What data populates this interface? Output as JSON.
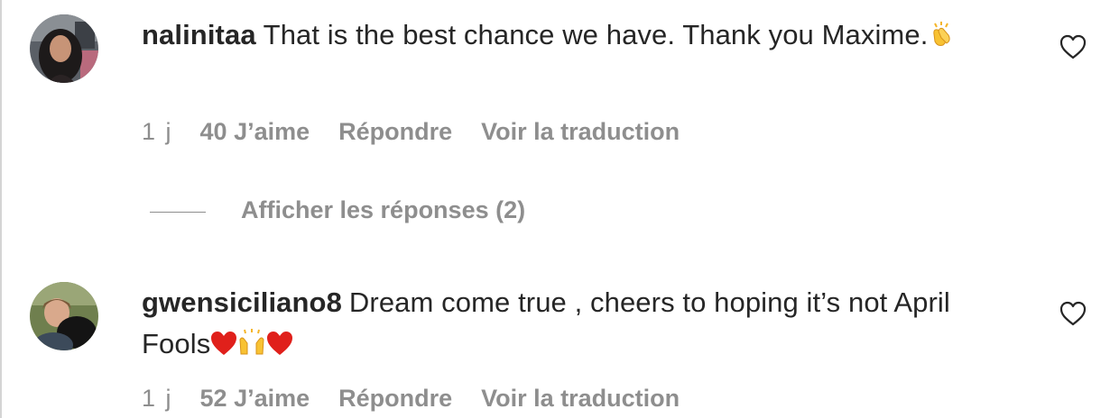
{
  "comments": [
    {
      "username": "nalinitaa",
      "text": "That is the best chance we have. Thank you Maxime.",
      "emoji": "clapping-hands",
      "time": "1 j",
      "likes": "40 J’aime",
      "reply_label": "Répondre",
      "translate_label": "Voir la traduction",
      "view_replies_label": "Afficher les réponses (2)",
      "like_icon": "heart-outline-icon"
    },
    {
      "username": "gwensiciliano8",
      "text": "Dream come true , cheers to hoping it’s not April Fools",
      "emoji": "heart, raising-hands, heart",
      "time": "1 j",
      "likes": "52 J’aime",
      "reply_label": "Répondre",
      "translate_label": "Voir la traduction",
      "like_icon": "heart-outline-icon"
    }
  ],
  "colors": {
    "text": "#262626",
    "secondary": "#8e8e8e",
    "heart_emoji": "#e0201b",
    "clap_emoji": "#f5b528"
  }
}
